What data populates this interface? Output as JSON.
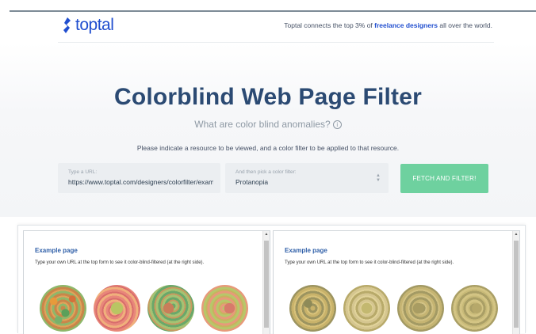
{
  "header": {
    "logo_text": "toptal",
    "tagline_prefix": "Toptal connects the top 3% of ",
    "tagline_link": "freelance designers",
    "tagline_suffix": " all over the world."
  },
  "hero": {
    "title": "Colorblind Web Page Filter",
    "subtitle": "What are color blind anomalies?",
    "info_icon": "i",
    "instruction": "Please indicate a resource to be viewed, and a color filter to be applied to that resource."
  },
  "form": {
    "url_label": "Type a URL:",
    "url_value": "https://www.toptal.com/designers/colorfilter/exam",
    "filter_label": "And then pick a color filter:",
    "filter_value": "Protanopia",
    "submit_label": "FETCH AND FILTER!"
  },
  "preview": {
    "left": {
      "title": "Example page",
      "description": "Type your own URL at the top form to see it color-blind-filtered (at the right side)."
    },
    "right": {
      "title": "Example page",
      "description": "Type your own URL at the top form to see it color-blind-filtered (at the right side)."
    }
  },
  "colors": {
    "brand_blue": "#204ecf",
    "title_navy": "#2b4a73",
    "button_green": "#6ed19f"
  }
}
